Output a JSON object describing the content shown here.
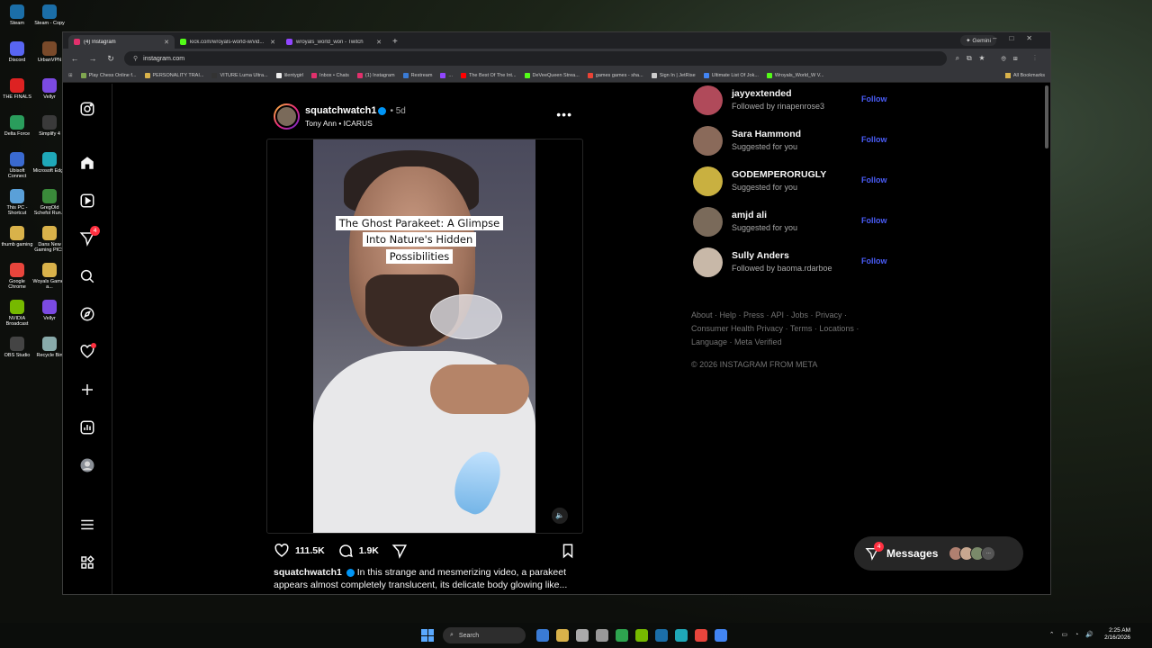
{
  "desktop": {
    "icons": [
      {
        "label": "Steam",
        "color": "#1b6ea8"
      },
      {
        "label": "Steam - Copy",
        "color": "#1b6ea8"
      },
      {
        "label": "Discord",
        "color": "#5865f2"
      },
      {
        "label": "UrbanVPN",
        "color": "#7a4a2a"
      },
      {
        "label": "THE FINALS",
        "color": "#d22"
      },
      {
        "label": "Vellyr",
        "color": "#7b4ae2"
      },
      {
        "label": "Delta Force",
        "color": "#2a9d5c"
      },
      {
        "label": "Simplify 4",
        "color": "#3a3a3a"
      },
      {
        "label": "Ubisoft Connect",
        "color": "#3a6ad0"
      },
      {
        "label": "Microsoft Edge",
        "color": "#1fa8b8"
      },
      {
        "label": "This PC - Shortcut",
        "color": "#5aa0d8"
      },
      {
        "label": "GregOld Schefol Run...",
        "color": "#3a8a3a"
      },
      {
        "label": "thumb gaming",
        "color": "#d9b24a"
      },
      {
        "label": "Dans New Gaming PICS",
        "color": "#d9b24a"
      },
      {
        "label": "Google Chrome",
        "color": "#e8453c"
      },
      {
        "label": "Woyals Games a...",
        "color": "#d9b24a"
      },
      {
        "label": "NVIDIA Broadcast",
        "color": "#76b900"
      },
      {
        "label": "Vellyr",
        "color": "#7b4ae2"
      },
      {
        "label": "OBS Studio",
        "color": "#444"
      },
      {
        "label": "Recycle Bin",
        "color": "#8aa"
      }
    ]
  },
  "taskbar": {
    "search": "Search",
    "time": "2:25 AM",
    "date": "2/16/2026",
    "apps": [
      "#3a7bd5",
      "#d9b24a",
      "#aaa",
      "#999",
      "#2ea44f",
      "#76b900",
      "#1b6ea8",
      "#1fa8b8",
      "#e8453c",
      "#4285f4"
    ]
  },
  "browser": {
    "tabs": [
      {
        "title": "(4) Instagram",
        "fav_color": "#e1306c",
        "active": true
      },
      {
        "title": "kick.com/wroyals-world-w/vid...",
        "fav_color": "#53fc18",
        "active": false
      },
      {
        "title": "wroyals_world_won - Twitch",
        "fav_color": "#9146ff",
        "active": false
      }
    ],
    "gemini_label": "Gemini",
    "url": "instagram.com",
    "bookmarks": [
      {
        "label": "Play Chess Online f...",
        "color": "#7fa650"
      },
      {
        "label": "PERSONALITY TRAI...",
        "color": "#d9b24a"
      },
      {
        "label": "VITURE Luma Ultra...",
        "color": "#333"
      },
      {
        "label": "lilentygirl",
        "color": "#eee"
      },
      {
        "label": "Inbox • Chats",
        "color": "#e1306c"
      },
      {
        "label": "(1) Instagram",
        "color": "#e1306c"
      },
      {
        "label": "Restream",
        "color": "#3a7bd5"
      },
      {
        "label": "...",
        "color": "#9146ff"
      },
      {
        "label": "The Best Of The Int...",
        "color": "#ff0000"
      },
      {
        "label": "DeVeeQueen Strea...",
        "color": "#53fc18"
      },
      {
        "label": "games games - sha...",
        "color": "#ea4335"
      },
      {
        "label": "Sign In | JetRise",
        "color": "#ccc"
      },
      {
        "label": "Ultimate List Of Jok...",
        "color": "#4285f4"
      },
      {
        "label": "Wroyals_World_W V...",
        "color": "#53fc18"
      }
    ],
    "all_bookmarks": "All Bookmarks"
  },
  "post": {
    "username": "squatchwatch1",
    "time": "5d",
    "audio": "Tony Ann • ICARUS",
    "overlay_text": "The Ghost Parakeet: A Glimpse Into Nature's Hidden Possibilities",
    "likes": "111.5K",
    "comments": "1.9K",
    "caption_user": "squatchwatch1",
    "caption": "In this strange and mesmerizing video, a parakeet appears almost completely translucent, its delicate body glowing like..."
  },
  "suggestions": [
    {
      "name": "jayyextended",
      "sub": "Followed by rinapenrose3",
      "follow": "Follow",
      "color": "#b04a5a"
    },
    {
      "name": "Sara Hammond",
      "sub": "Suggested for you",
      "follow": "Follow",
      "color": "#8a6a5a"
    },
    {
      "name": "GODEMPERORUGLY",
      "sub": "Suggested for you",
      "follow": "Follow",
      "color": "#c9b040"
    },
    {
      "name": "amjd ali",
      "sub": "Suggested for you",
      "follow": "Follow",
      "color": "#7a6a5a"
    },
    {
      "name": "Sully Anders",
      "sub": "Followed by baoma.rdarboe",
      "follow": "Follow",
      "color": "#c8b8a8"
    }
  ],
  "footer": {
    "links": "About · Help · Press · API · Jobs · Privacy · Consumer Health Privacy · Terms · Locations · Language · Meta Verified",
    "copyright": "© 2026 INSTAGRAM FROM META"
  },
  "messages": {
    "label": "Messages",
    "badge": "4",
    "more": "..."
  },
  "nav": {
    "notifications_badge": "4"
  }
}
